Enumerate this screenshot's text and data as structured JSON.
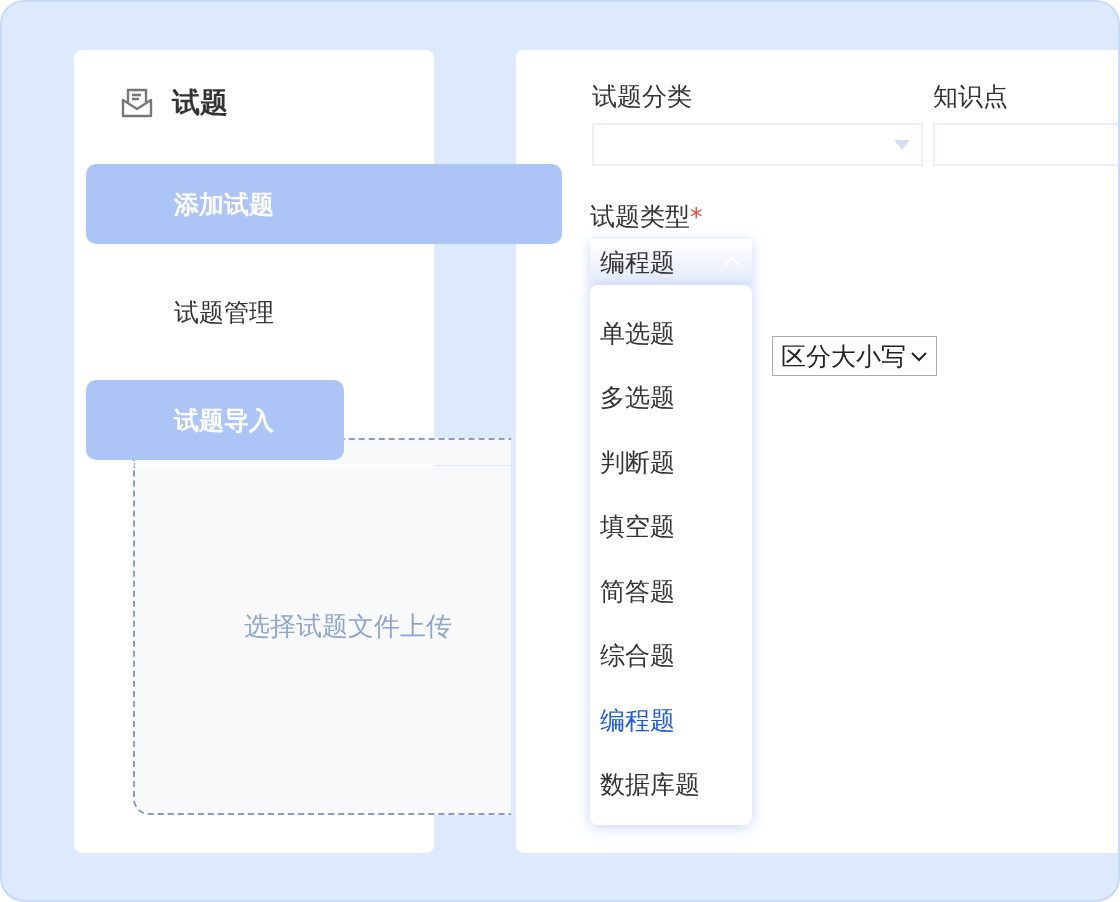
{
  "sidebar": {
    "title": "试题",
    "items": [
      {
        "label": "添加试题",
        "selected": true
      },
      {
        "label": "试题管理",
        "selected": false
      },
      {
        "label": "试题导入",
        "selected": true
      }
    ]
  },
  "upload": {
    "label": "选择试题文件上传"
  },
  "form": {
    "category": {
      "label": "试题分类"
    },
    "knowledge": {
      "label": "知识点"
    },
    "type": {
      "label": "试题类型",
      "required_mark": "*",
      "value": "编程题",
      "expanded": true,
      "options": [
        {
          "label": "单选题",
          "selected": false
        },
        {
          "label": "多选题",
          "selected": false
        },
        {
          "label": "判断题",
          "selected": false
        },
        {
          "label": "填空题",
          "selected": false
        },
        {
          "label": "简答题",
          "selected": false
        },
        {
          "label": "综合题",
          "selected": false
        },
        {
          "label": "编程题",
          "selected": true
        },
        {
          "label": "数据库题",
          "selected": false
        }
      ]
    },
    "case_select": {
      "value": "区分大小写"
    }
  }
}
